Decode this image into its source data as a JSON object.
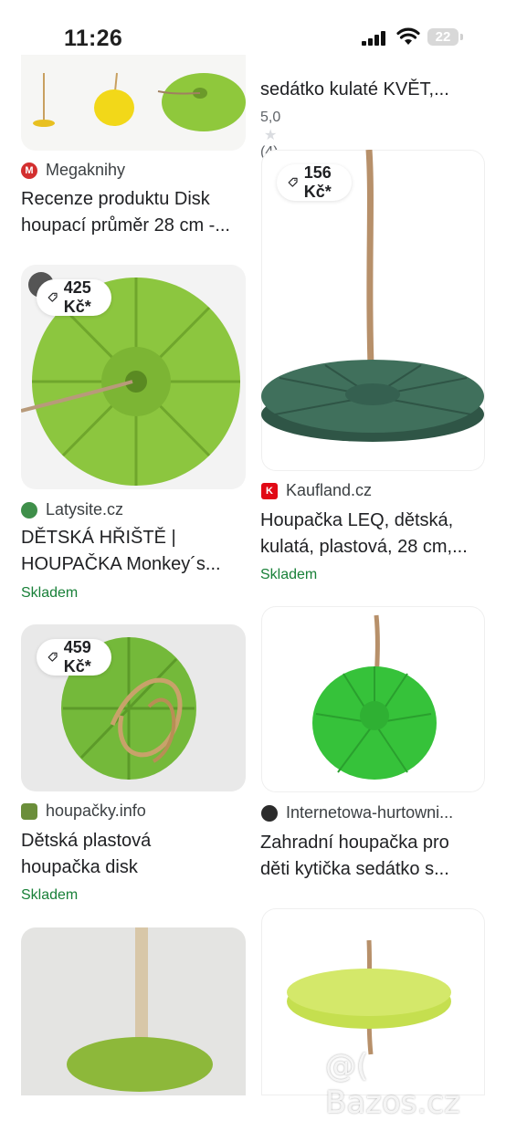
{
  "status_bar": {
    "time": "11:26",
    "battery": "22"
  },
  "left_column": [
    {
      "source": "Megaknihy",
      "title_line1": "Recenze produktu Disk",
      "title_line2": "houpací průměr 28 cm -..."
    },
    {
      "price": "425 Kč*",
      "source": "Latysite.cz",
      "title_line1": "DĚTSKÁ HŘIŠTĚ |",
      "title_line2": "HOUPAČKA Monkey´s...",
      "stock": "Skladem"
    },
    {
      "price": "459 Kč*",
      "source": "houpačky.info",
      "title_line1": "Dětská plastová",
      "title_line2": "houpačka disk",
      "stock": "Skladem"
    }
  ],
  "right_column": [
    {
      "title_line2": "sedátko kulaté KVĚT,...",
      "rating_value": "5,0",
      "rating_count": "(4)"
    },
    {
      "price": "156 Kč*",
      "source": "Kaufland.cz",
      "title_line1": "Houpačka LEQ, dětská,",
      "title_line2": "kulatá, plastová, 28 cm,...",
      "stock": "Skladem"
    },
    {
      "source": "Internetowa-hurtowni...",
      "title_line1": "Zahradní houpačka pro",
      "title_line2": "děti kytička sedátko s..."
    }
  ],
  "watermark": "@( Bazos.cz",
  "colors": {
    "stock_green": "#188038",
    "megaknihy_red": "#d32f2f",
    "kaufland_red": "#e10915",
    "lime_disk": "#8cc63f",
    "dark_green_disk": "#3f6a57",
    "bright_green_disk": "#36c23a"
  },
  "icons": [
    "signal-icon",
    "wifi-icon",
    "battery-icon",
    "price-tag-icon",
    "star-icon"
  ]
}
